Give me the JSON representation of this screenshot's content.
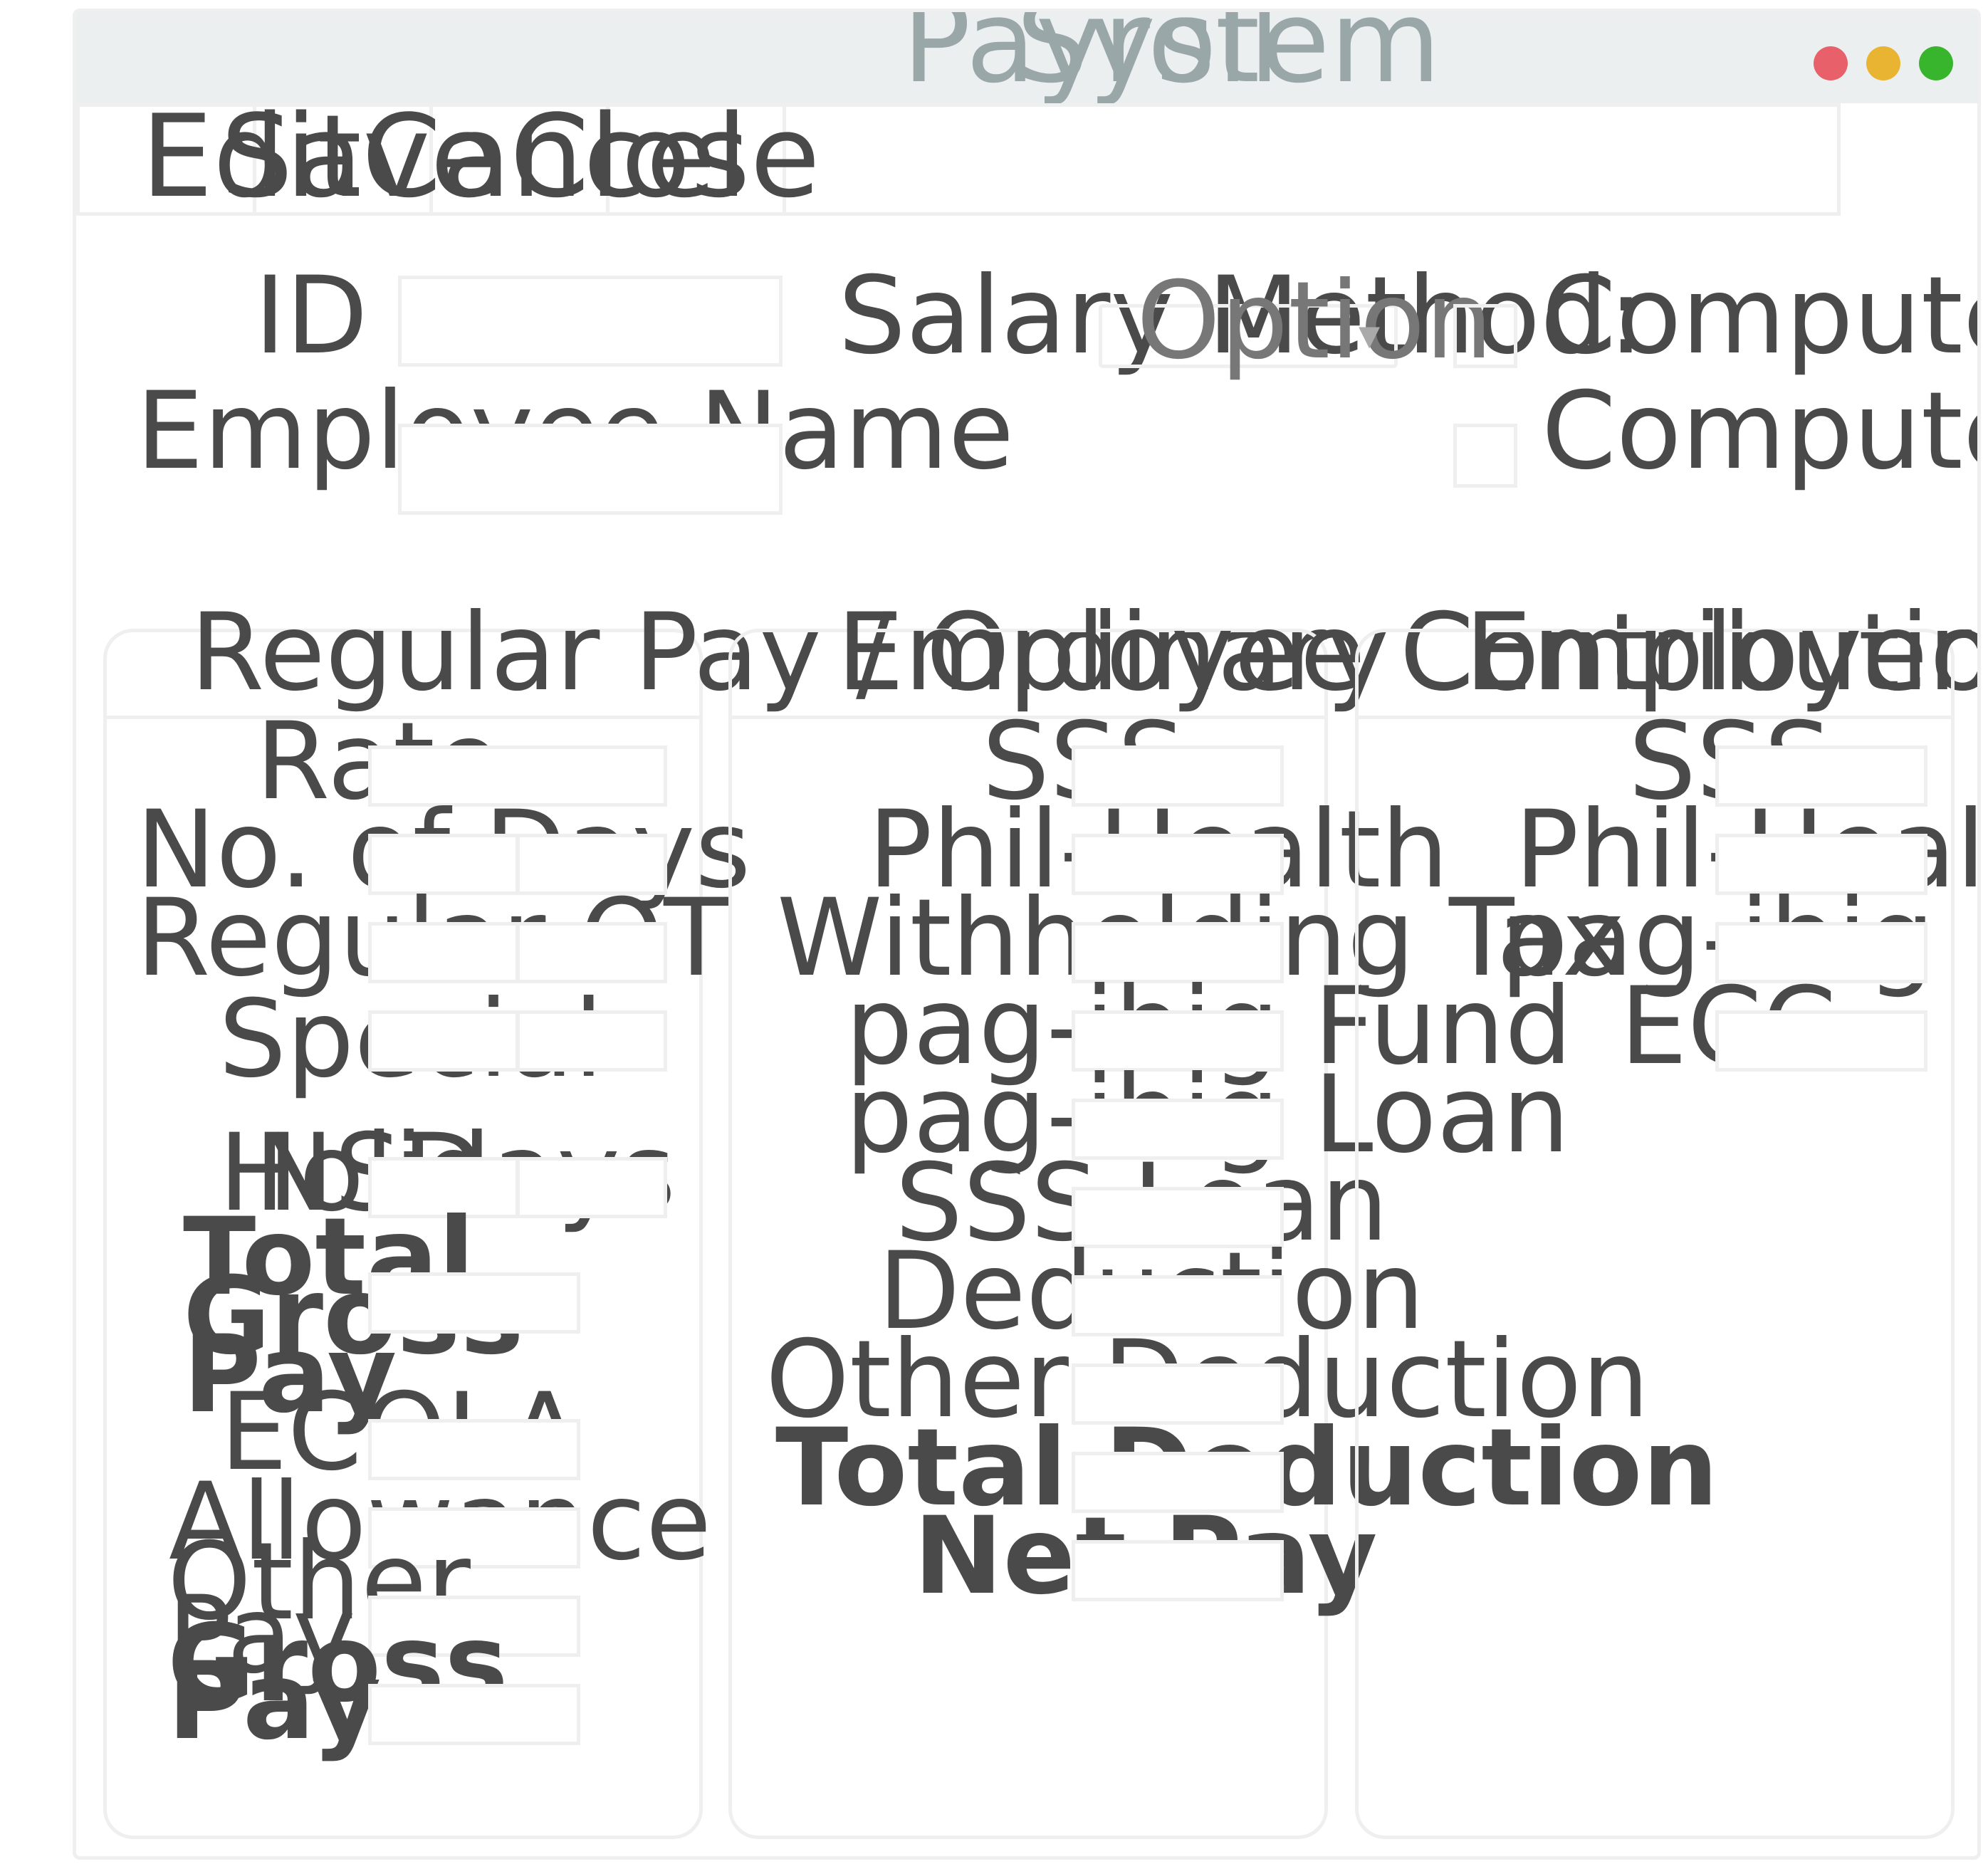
{
  "window": {
    "title_a": "Payroll",
    "title_b": "System",
    "controls": {
      "close_color": "#e8616a",
      "minimize_color": "#e8b431",
      "maximize_color": "#38b52c"
    }
  },
  "toolbar": {
    "edit_label": "Edit",
    "save_label": "Save",
    "cancel_label": "Cancel",
    "close_label": "Close"
  },
  "employee": {
    "id_label": "ID",
    "id_value": "",
    "name_label": "Employee Name",
    "name_value": ""
  },
  "salary": {
    "method_label": "Salary Method:",
    "select_value": "Option",
    "compute_allowance_label": "Compute Attendance",
    "compute_contribution_label": "Compute Contribution"
  },
  "regular_pay": {
    "header": "Regular Pay / Ordinary",
    "rate_label": "Rate",
    "no_days_label": "No. of Days",
    "regular_ot_label": "Regular OT",
    "special_holidays_label": "Special Holidays",
    "nsd_label": "NSD",
    "total_gross_pay_label": "Total Gross Pay",
    "ecola_label": "ECOLA",
    "allowance_label": "Allowance",
    "other_pay_label": "Other Pay",
    "gross_pay_label": "Gross Pay"
  },
  "employee_contribution": {
    "header": "Employee Contribution",
    "sss_label": "SSS",
    "phil_health_label": "Phil-Health",
    "withholding_tax_label": "Withholding Tax",
    "pag_ibig_fund_label": "pag-ibig Fund",
    "pag_ibig_loan_label": "pag-ibig Loan",
    "sss_loan_label": "SSS Loan",
    "deduction_label": "Deduction",
    "other_deduction_label": "Other Deduction",
    "total_deduction_label": "Total Deduction",
    "net_pay_label": "Net Pay"
  },
  "employer_contribution": {
    "header": "Employer Contribution",
    "sss_label": "SSS",
    "phil_health_label": "Phil-Health",
    "pag_ibig_fund_label": "pag-ibig Fund",
    "ecc_label": "ECC"
  }
}
